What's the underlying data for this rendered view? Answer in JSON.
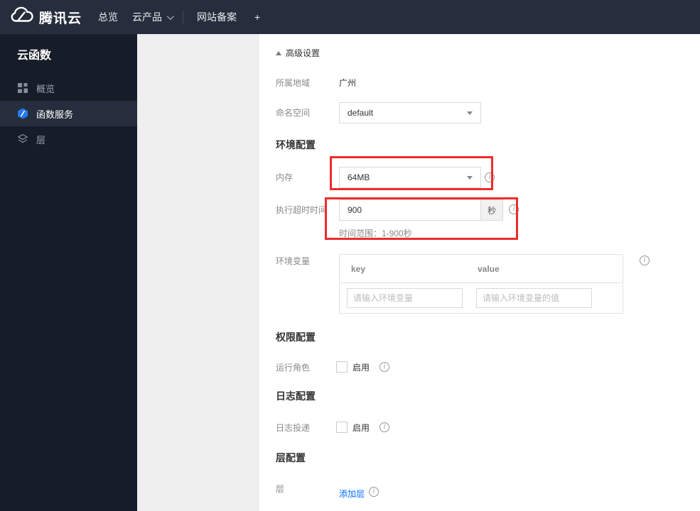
{
  "colors": {
    "accent_blue": "#006eff",
    "annotation_red": "#ee2c2c",
    "topbar_bg": "#262d3c",
    "sidebar_bg": "#171d28",
    "sidebar_selected_bg": "#262e3d"
  },
  "icons": {
    "info": "i"
  },
  "topbar": {
    "brand": "腾讯云",
    "overview": "总览",
    "products": "云产品",
    "beian": "网站备案",
    "plus": "+"
  },
  "sidebar": {
    "title": "云函数",
    "items": [
      {
        "label": "概览"
      },
      {
        "label": "函数服务"
      },
      {
        "label": "层"
      }
    ]
  },
  "content": {
    "advanced_toggle": "高级设置",
    "region": {
      "label": "所属地域",
      "value": "广州"
    },
    "namespace": {
      "label": "命名空间",
      "value": "default"
    },
    "section_env": "环境配置",
    "memory": {
      "label": "内存",
      "value": "64MB"
    },
    "timeout": {
      "label": "执行超时时间",
      "value": "900",
      "unit": "秒",
      "hint": "时间范围：1-900秒"
    },
    "env_vars": {
      "label": "环境变量",
      "key_header": "key",
      "value_header": "value",
      "key_placeholder": "请输入环境变量",
      "value_placeholder": "请输入环境变量的值"
    },
    "section_perm": "权限配置",
    "run_role": {
      "label": "运行角色",
      "enable": "启用"
    },
    "section_log": "日志配置",
    "log_delivery": {
      "label": "日志投递",
      "enable": "启用"
    },
    "section_layer": "层配置",
    "layer": {
      "label": "层",
      "add_link": "添加层"
    }
  }
}
